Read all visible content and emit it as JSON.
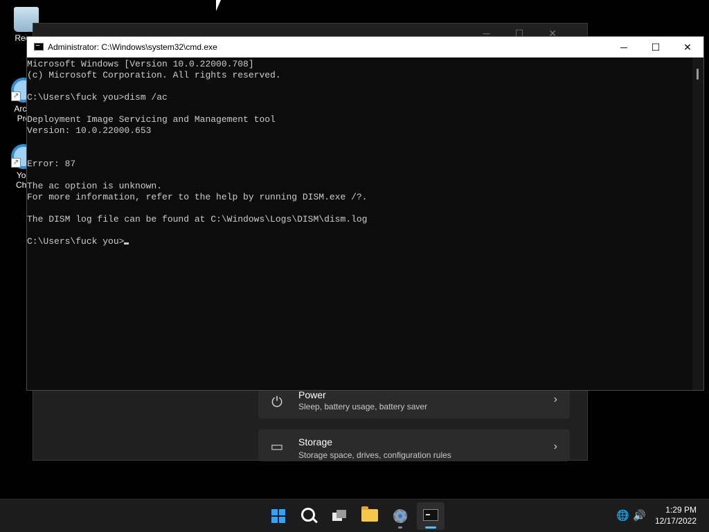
{
  "desktop": {
    "icons": [
      {
        "label_1": "Recyc",
        "label_2": "",
        "kind": "recycle-bin"
      },
      {
        "label_1": "Archi",
        "label_2": "Pro",
        "kind": "internet-explorer"
      },
      {
        "label_1": "You",
        "label_2": "Cha",
        "kind": "internet-explorer"
      }
    ]
  },
  "settings": {
    "cards": [
      {
        "title": "Power",
        "subtitle": "Sleep, battery usage, battery saver",
        "icon": "power-icon"
      },
      {
        "title": "Storage",
        "subtitle": "Storage space, drives, configuration rules",
        "icon": "storage-icon"
      }
    ]
  },
  "cmd": {
    "title": "Administrator: C:\\Windows\\system32\\cmd.exe",
    "lines": [
      "Microsoft Windows [Version 10.0.22000.708]",
      "(c) Microsoft Corporation. All rights reserved.",
      "",
      "C:\\Users\\fuck you>dism /ac",
      "",
      "Deployment Image Servicing and Management tool",
      "Version: 10.0.22000.653",
      "",
      "",
      "Error: 87",
      "",
      "The ac option is unknown.",
      "For more information, refer to the help by running DISM.exe /?.",
      "",
      "The DISM log file can be found at C:\\Windows\\Logs\\DISM\\dism.log",
      ""
    ],
    "prompt": "C:\\Users\\fuck you>",
    "minimize_glyph": "─",
    "maximize_glyph": "☐",
    "close_glyph": "✕"
  },
  "taskbar": {
    "apps": [
      "start",
      "search",
      "task-view",
      "file-explorer",
      "settings",
      "command-prompt"
    ],
    "time": "1:29 PM",
    "date": "12/17/2022",
    "colors": {
      "accent": "#2fa4ff",
      "indicator_active": "#4cc2ff",
      "indicator_inactive": "#8a8a8a"
    }
  }
}
